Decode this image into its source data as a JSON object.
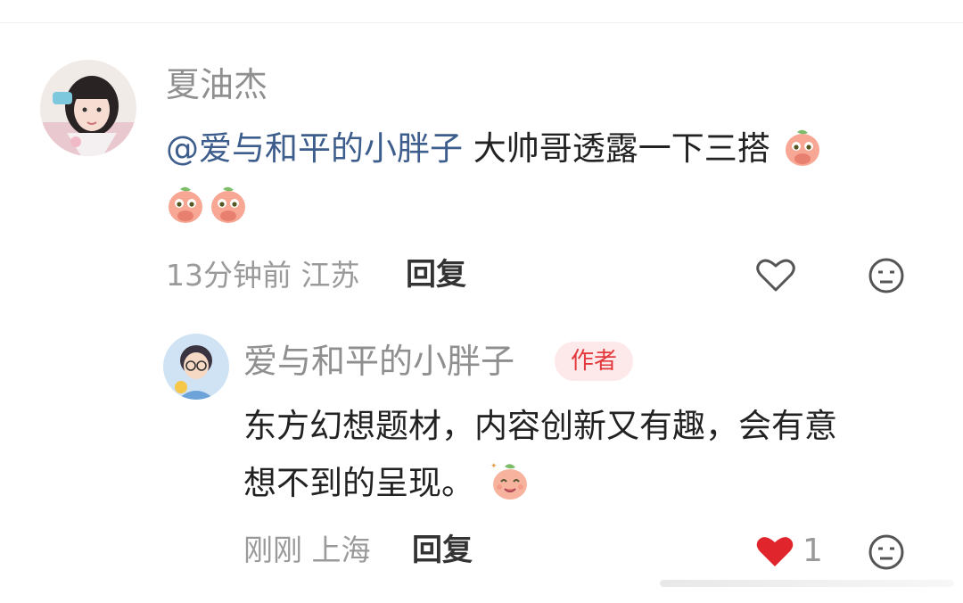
{
  "comment": {
    "author": "夏油杰",
    "mention": "@爱与和平的小胖子",
    "text": "大帅哥透露一下三搭",
    "emoji_name": "peach-cover-mouth-emoji",
    "time": "13分钟前",
    "location": "江苏",
    "reply_label": "回复"
  },
  "reply": {
    "author": "爱与和平的小胖子",
    "badge": "作者",
    "line1": "东方幻想题材，内容创新又有趣，会有意",
    "line2": "想不到的呈现。",
    "emoji_name": "peach-smile-emoji",
    "time": "刚刚",
    "location": "上海",
    "reply_label": "回复",
    "like_count": "1",
    "liked": true
  },
  "colors": {
    "mention": "#3d5d8c",
    "badge_text": "#e4393c",
    "badge_bg": "#fde8ea",
    "like_active": "#e0262c"
  }
}
